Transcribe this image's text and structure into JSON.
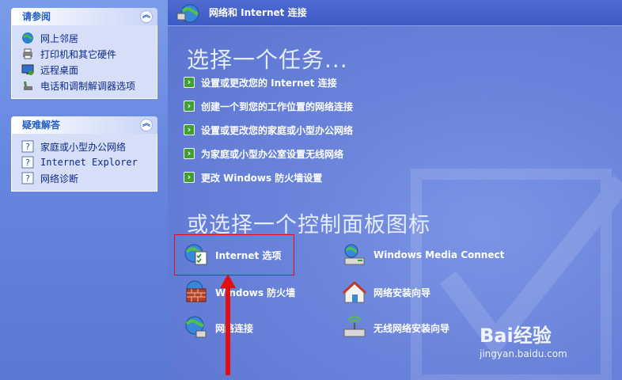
{
  "header": {
    "title": "网络和 Internet 连接"
  },
  "see_also": {
    "title": "请参阅",
    "items": [
      {
        "label": "网上邻居",
        "icon": "network-places-icon"
      },
      {
        "label": "打印机和其它硬件",
        "icon": "printer-icon"
      },
      {
        "label": "远程桌面",
        "icon": "remote-desktop-icon"
      },
      {
        "label": "电话和调制解调器选项",
        "icon": "phone-icon"
      }
    ]
  },
  "troubleshoot": {
    "title": "疑难解答",
    "items": [
      {
        "label": "家庭或小型办公网络",
        "icon": "help-icon"
      },
      {
        "label": "Internet Explorer",
        "icon": "help-icon"
      },
      {
        "label": "网络诊断",
        "icon": "help-icon"
      }
    ]
  },
  "tasks": {
    "heading": "选择一个任务...",
    "items": [
      {
        "label": "设置或更改您的 Internet 连接"
      },
      {
        "label": "创建一个到您的工作位置的网络连接"
      },
      {
        "label": "设置或更改您的家庭或小型办公网络"
      },
      {
        "label": "为家庭或小型办公室设置无线网络"
      },
      {
        "label": "更改 Windows 防火墙设置"
      }
    ]
  },
  "control_panel": {
    "heading": "或选择一个控制面板图标",
    "items": [
      {
        "label": "Internet 选项",
        "icon": "internet-options-icon"
      },
      {
        "label": "Windows Media Connect",
        "icon": "media-connect-icon"
      },
      {
        "label": "Windows 防火墙",
        "icon": "firewall-icon"
      },
      {
        "label": "网络安装向导",
        "icon": "network-setup-icon"
      },
      {
        "label": "网络连接",
        "icon": "network-connections-icon"
      },
      {
        "label": "无线网络安装向导",
        "icon": "wireless-setup-icon"
      }
    ]
  },
  "watermark": {
    "brand": "Bai经验",
    "url": "jingyan.baidu.com"
  },
  "colors": {
    "highlight": "#e01010",
    "task_arrow": "#3ea032"
  }
}
